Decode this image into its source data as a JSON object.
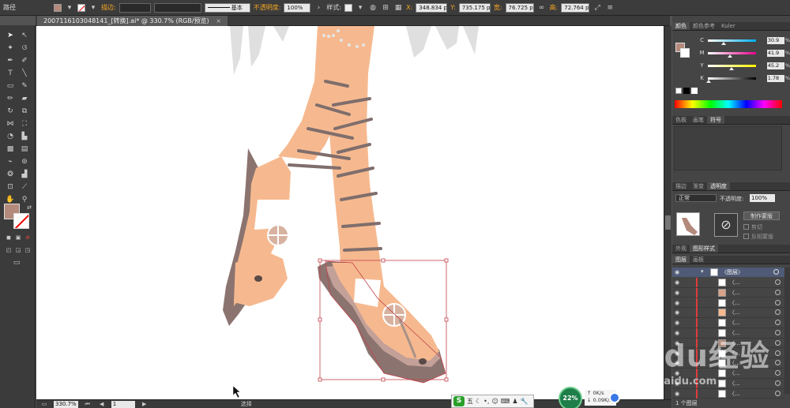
{
  "control_bar": {
    "object_type": "路径",
    "fill_color": "#b38a7c",
    "stroke_label": "描边:",
    "brush_label": "基本",
    "opacity_label": "不透明度:",
    "opacity_value": "100%",
    "style_label": "样式:",
    "x_label": "X:",
    "x_value": "348.834 p",
    "y_label": "Y:",
    "y_value": "735.175 p",
    "w_label": "宽:",
    "w_value": "76.725 p",
    "h_label": "高:",
    "h_value": "72.764 p"
  },
  "document_tab": {
    "title": "2007116103048141_[转换].ai* @ 330.7% (RGB/预览)",
    "close": "×"
  },
  "status_bar": {
    "zoom": "330.7%",
    "page": "1",
    "tool_state": "选择"
  },
  "color_panel": {
    "tabs": [
      "颜色",
      "颜色参考",
      "Kuler"
    ],
    "channels": [
      {
        "label": "C",
        "value": "30.9",
        "fraction": 0.31
      },
      {
        "label": "M",
        "value": "41.9",
        "fraction": 0.42
      },
      {
        "label": "Y",
        "value": "45.2",
        "fraction": 0.45
      },
      {
        "label": "K",
        "value": "1.78",
        "fraction": 0.02
      }
    ],
    "pct": "%"
  },
  "swatch_panel": {
    "tabs": [
      "色板",
      "画笔",
      "符号"
    ]
  },
  "transparency_panel": {
    "tabs": [
      "描边",
      "渐变",
      "透明度"
    ],
    "blend_mode": "正常",
    "opacity_label": "不透明度:",
    "opacity_value": "100%",
    "make_mask": "制作蒙版",
    "clip": "剪切",
    "invert": "反相蒙版"
  },
  "appearance_panel": {
    "tabs": [
      "外观",
      "图形样式"
    ]
  },
  "layers_panel": {
    "tabs": [
      "图层",
      "画板"
    ],
    "top_layer": "〈图层〉",
    "footer": "1 个图层",
    "rows": [
      "〈...",
      "〈...",
      "〈...",
      "〈...",
      "〈...",
      "〈...",
      "〈...",
      "〈...",
      "〈...",
      "〈...",
      "〈...",
      "〈..."
    ]
  },
  "ime": {
    "logo": "S",
    "mode": "五"
  },
  "network": {
    "percent": "22%",
    "up": "0K/s",
    "down": "0.09K/s"
  },
  "watermark": {
    "main": "Baidu经验",
    "sub": "jingyan.baidu.com"
  }
}
